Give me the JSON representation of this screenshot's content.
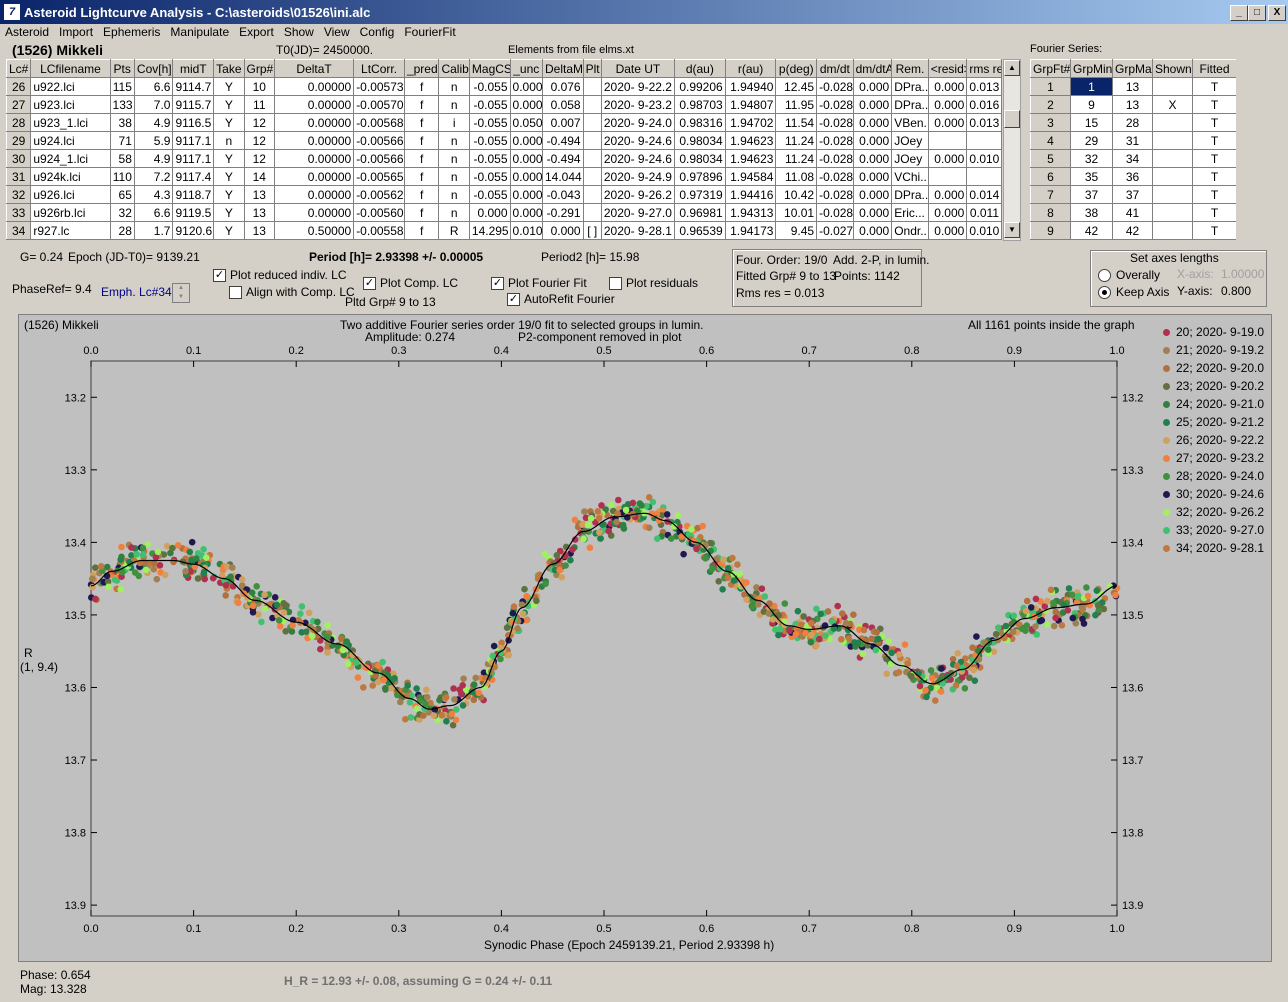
{
  "window": {
    "title": "Asteroid Lightcurve Analysis - C:\\asteroids\\01526\\ini.alc",
    "min": "_",
    "max": "□",
    "close": "X",
    "app_icon": "7"
  },
  "menu": [
    "Asteroid",
    "Import",
    "Ephemeris",
    "Manipulate",
    "Export",
    "Show",
    "View",
    "Config",
    "FourierFit"
  ],
  "header": {
    "asteroid": "(1526) Mikkeli",
    "t0": "T0(JD)= 2450000.",
    "elements": "Elements from file elms.xt",
    "fourier_label": "Fourier Series:"
  },
  "lc_table": {
    "columns": [
      "Lc#",
      "LCfilename",
      "Pts",
      "Cov[h]",
      "midT",
      "Take",
      "Grp#",
      "DeltaT",
      "LtCorr.",
      "_pred.",
      "Calib.",
      "MagCS",
      "_unc",
      "DeltaM",
      "Plt",
      "Date UT",
      "d(au)",
      "r(au)",
      "p(deg)",
      "dm/dt",
      "dm/dtA",
      "Rem.",
      "<resid>",
      "rms res"
    ],
    "rows": [
      [
        "26",
        "u922.lci",
        "115",
        "6.6",
        "9114.7",
        "Y",
        "10",
        "0.00000",
        "-0.00573",
        "f",
        "n",
        "-0.055",
        "0.000",
        "0.076",
        "",
        "2020- 9-22.2",
        "0.99206",
        "1.94940",
        "12.45",
        "-0.028",
        "0.000",
        "DPra...",
        "0.000",
        "0.013"
      ],
      [
        "27",
        "u923.lci",
        "133",
        "7.0",
        "9115.7",
        "Y",
        "11",
        "0.00000",
        "-0.00570",
        "f",
        "n",
        "-0.055",
        "0.000",
        "0.058",
        "",
        "2020- 9-23.2",
        "0.98703",
        "1.94807",
        "11.95",
        "-0.028",
        "0.000",
        "DPra...",
        "0.000",
        "0.016"
      ],
      [
        "28",
        "u923_1.lci",
        "38",
        "4.9",
        "9116.5",
        "Y",
        "12",
        "0.00000",
        "-0.00568",
        "f",
        "i",
        "-0.055",
        "0.050",
        "0.007",
        "",
        "2020- 9-24.0",
        "0.98316",
        "1.94702",
        "11.54",
        "-0.028",
        "0.000",
        "VBen...",
        "0.000",
        "0.013"
      ],
      [
        "29",
        "u924.lci",
        "71",
        "5.9",
        "9117.1",
        "n",
        "12",
        "0.00000",
        "-0.00566",
        "f",
        "n",
        "-0.055",
        "0.000",
        "-0.494",
        "",
        "2020- 9-24.6",
        "0.98034",
        "1.94623",
        "11.24",
        "-0.028",
        "0.000",
        "JOey",
        "",
        ""
      ],
      [
        "30",
        "u924_1.lci",
        "58",
        "4.9",
        "9117.1",
        "Y",
        "12",
        "0.00000",
        "-0.00566",
        "f",
        "n",
        "-0.055",
        "0.000",
        "-0.494",
        "",
        "2020- 9-24.6",
        "0.98034",
        "1.94623",
        "11.24",
        "-0.028",
        "0.000",
        "JOey",
        "0.000",
        "0.010"
      ],
      [
        "31",
        "u924k.lci",
        "110",
        "7.2",
        "9117.4",
        "Y",
        "14",
        "0.00000",
        "-0.00565",
        "f",
        "n",
        "-0.055",
        "0.000",
        "14.044",
        "",
        "2020- 9-24.9",
        "0.97896",
        "1.94584",
        "11.08",
        "-0.028",
        "0.000",
        "VChi...",
        "",
        ""
      ],
      [
        "32",
        "u926.lci",
        "65",
        "4.3",
        "9118.7",
        "Y",
        "13",
        "0.00000",
        "-0.00562",
        "f",
        "n",
        "-0.055",
        "0.000",
        "-0.043",
        "",
        "2020- 9-26.2",
        "0.97319",
        "1.94416",
        "10.42",
        "-0.028",
        "0.000",
        "DPra...",
        "0.000",
        "0.014"
      ],
      [
        "33",
        "u926rb.lci",
        "32",
        "6.6",
        "9119.5",
        "Y",
        "13",
        "0.00000",
        "-0.00560",
        "f",
        "n",
        "0.000",
        "0.000",
        "-0.291",
        "",
        "2020- 9-27.0",
        "0.96981",
        "1.94313",
        "10.01",
        "-0.028",
        "0.000",
        "Eric...",
        "0.000",
        "0.011"
      ],
      [
        "34",
        "r927.lc",
        "28",
        "1.7",
        "9120.6",
        "Y",
        "13",
        "0.50000",
        "-0.00558",
        "f",
        "R",
        "14.295",
        "0.010",
        "0.000",
        "[ ]",
        "2020- 9-28.1",
        "0.96539",
        "1.94173",
        "9.45",
        "-0.027",
        "0.000",
        "Ondr...",
        "0.000",
        "0.010"
      ]
    ]
  },
  "fourier_table": {
    "columns": [
      "GrpFt#",
      "GrpMin",
      "GrpMax",
      "Shown",
      "Fitted"
    ],
    "rows": [
      [
        "1",
        "1",
        "13",
        "",
        "T"
      ],
      [
        "2",
        "9",
        "13",
        "X",
        "T"
      ],
      [
        "3",
        "15",
        "28",
        "",
        "T"
      ],
      [
        "4",
        "29",
        "31",
        "",
        "T"
      ],
      [
        "5",
        "32",
        "34",
        "",
        "T"
      ],
      [
        "6",
        "35",
        "36",
        "",
        "T"
      ],
      [
        "7",
        "37",
        "37",
        "",
        "T"
      ],
      [
        "8",
        "38",
        "41",
        "",
        "T"
      ],
      [
        "9",
        "42",
        "42",
        "",
        "T"
      ]
    ]
  },
  "controls": {
    "g": "G= 0.24",
    "epoch": "Epoch (JD-T0)= 9139.21",
    "period": "Period [h]= 2.93398 +/- 0.00005",
    "period2": "Period2 [h]= 15.98",
    "phaseref": "PhaseRef= 9.4",
    "emph": "Emph. Lc#34:",
    "plot_reduced": "Plot reduced indiv. LC",
    "align": "Align with Comp. LC",
    "plot_comp": "Plot Comp. LC",
    "pltd_grp": "Pltd Grp#  9   to   13",
    "plot_fourier": "Plot Fourier Fit",
    "autorefit": "AutoRefit Fourier",
    "plot_residuals": "Plot residuals",
    "four_order": "Four. Order: 19/0",
    "add2p": "Add. 2-P, in lumin.",
    "fitted_grp": "Fitted Grp# 9 to 13",
    "points": "Points: 1142",
    "rms": "Rms res      = 0.013",
    "axes_title": "Set axes lengths",
    "overally": "Overally",
    "keep_axis": "Keep Axis",
    "x_axis": "X-axis:",
    "x_val": "1.00000",
    "y_axis": "Y-axis:",
    "y_val": "0.800",
    "check_mark": "✓",
    "spin_up": "▲",
    "spin_down": "▼",
    "scroll_up": "▲",
    "scroll_down": "▼"
  },
  "plot": {
    "asteroid": "(1526) Mikkeli",
    "title1": "Two additive Fourier series order 19/0 fit to selected groups in lumin.",
    "amplitude": "Amplitude: 0.274",
    "p2": "P2-component removed in plot",
    "points_inside": "All 1161 points inside the graph",
    "ylabel1": "R",
    "ylabel2": "(1, 9.4)",
    "xlabel": "Synodic Phase (Epoch 2459139.21, Period 2.93398 h)",
    "legend": [
      {
        "label": "20; 2020- 9-19.0",
        "color": "#b03050"
      },
      {
        "label": "21; 2020- 9-19.2",
        "color": "#a08050"
      },
      {
        "label": "22; 2020- 9-20.0",
        "color": "#b07040"
      },
      {
        "label": "23; 2020- 9-20.2",
        "color": "#607040"
      },
      {
        "label": "24; 2020- 9-21.0",
        "color": "#308040"
      },
      {
        "label": "25; 2020- 9-21.2",
        "color": "#208050"
      },
      {
        "label": "26; 2020- 9-22.2",
        "color": "#d0a060"
      },
      {
        "label": "27; 2020- 9-23.2",
        "color": "#f08040"
      },
      {
        "label": "28; 2020- 9-24.0",
        "color": "#409040"
      },
      {
        "label": "30; 2020- 9-24.6",
        "color": "#201850"
      },
      {
        "label": "32; 2020- 9-26.2",
        "color": "#a0f060"
      },
      {
        "label": "33; 2020- 9-27.0",
        "color": "#40c070"
      },
      {
        "label": "34; 2020- 9-28.1",
        "color": "#c07840"
      }
    ]
  },
  "chart_data": {
    "type": "scatter",
    "title": "Two additive Fourier series order 19/0 fit to selected groups in lumin.",
    "xlabel": "Synodic Phase (Epoch 2459139.21, Period 2.93398 h)",
    "ylabel": "R (1, 9.4)",
    "xlim": [
      0.0,
      1.0
    ],
    "ylim": [
      13.9,
      13.1
    ],
    "x_ticks": [
      "0.0",
      "0.1",
      "0.2",
      "0.3",
      "0.4",
      "0.5",
      "0.6",
      "0.7",
      "0.8",
      "0.9",
      "1.0"
    ],
    "y_ticks": [
      "13.2",
      "13.3",
      "13.4",
      "13.5",
      "13.6",
      "13.7",
      "13.8",
      "13.9"
    ],
    "y_tick_values": [
      13.2,
      13.3,
      13.4,
      13.5,
      13.6,
      13.7,
      13.8,
      13.9
    ],
    "fit_curve": {
      "x": [
        0.0,
        0.02,
        0.05,
        0.08,
        0.1,
        0.13,
        0.16,
        0.2,
        0.24,
        0.28,
        0.31,
        0.33,
        0.35,
        0.38,
        0.4,
        0.42,
        0.45,
        0.48,
        0.51,
        0.54,
        0.56,
        0.59,
        0.62,
        0.65,
        0.68,
        0.7,
        0.73,
        0.76,
        0.79,
        0.82,
        0.85,
        0.88,
        0.91,
        0.94,
        0.97,
        1.0
      ],
      "y": [
        13.46,
        13.44,
        13.425,
        13.425,
        13.43,
        13.45,
        13.48,
        13.51,
        13.54,
        13.58,
        13.615,
        13.63,
        13.625,
        13.6,
        13.55,
        13.49,
        13.43,
        13.385,
        13.365,
        13.36,
        13.37,
        13.4,
        13.44,
        13.48,
        13.515,
        13.52,
        13.515,
        13.54,
        13.57,
        13.595,
        13.575,
        13.535,
        13.505,
        13.49,
        13.485,
        13.46
      ]
    },
    "series_count": 13
  },
  "status": {
    "phase": "Phase:  0.654",
    "mag": "Mag:    13.328",
    "h_r": "H_R = 12.93 +/- 0.08, assuming G = 0.24 +/- 0.11"
  }
}
